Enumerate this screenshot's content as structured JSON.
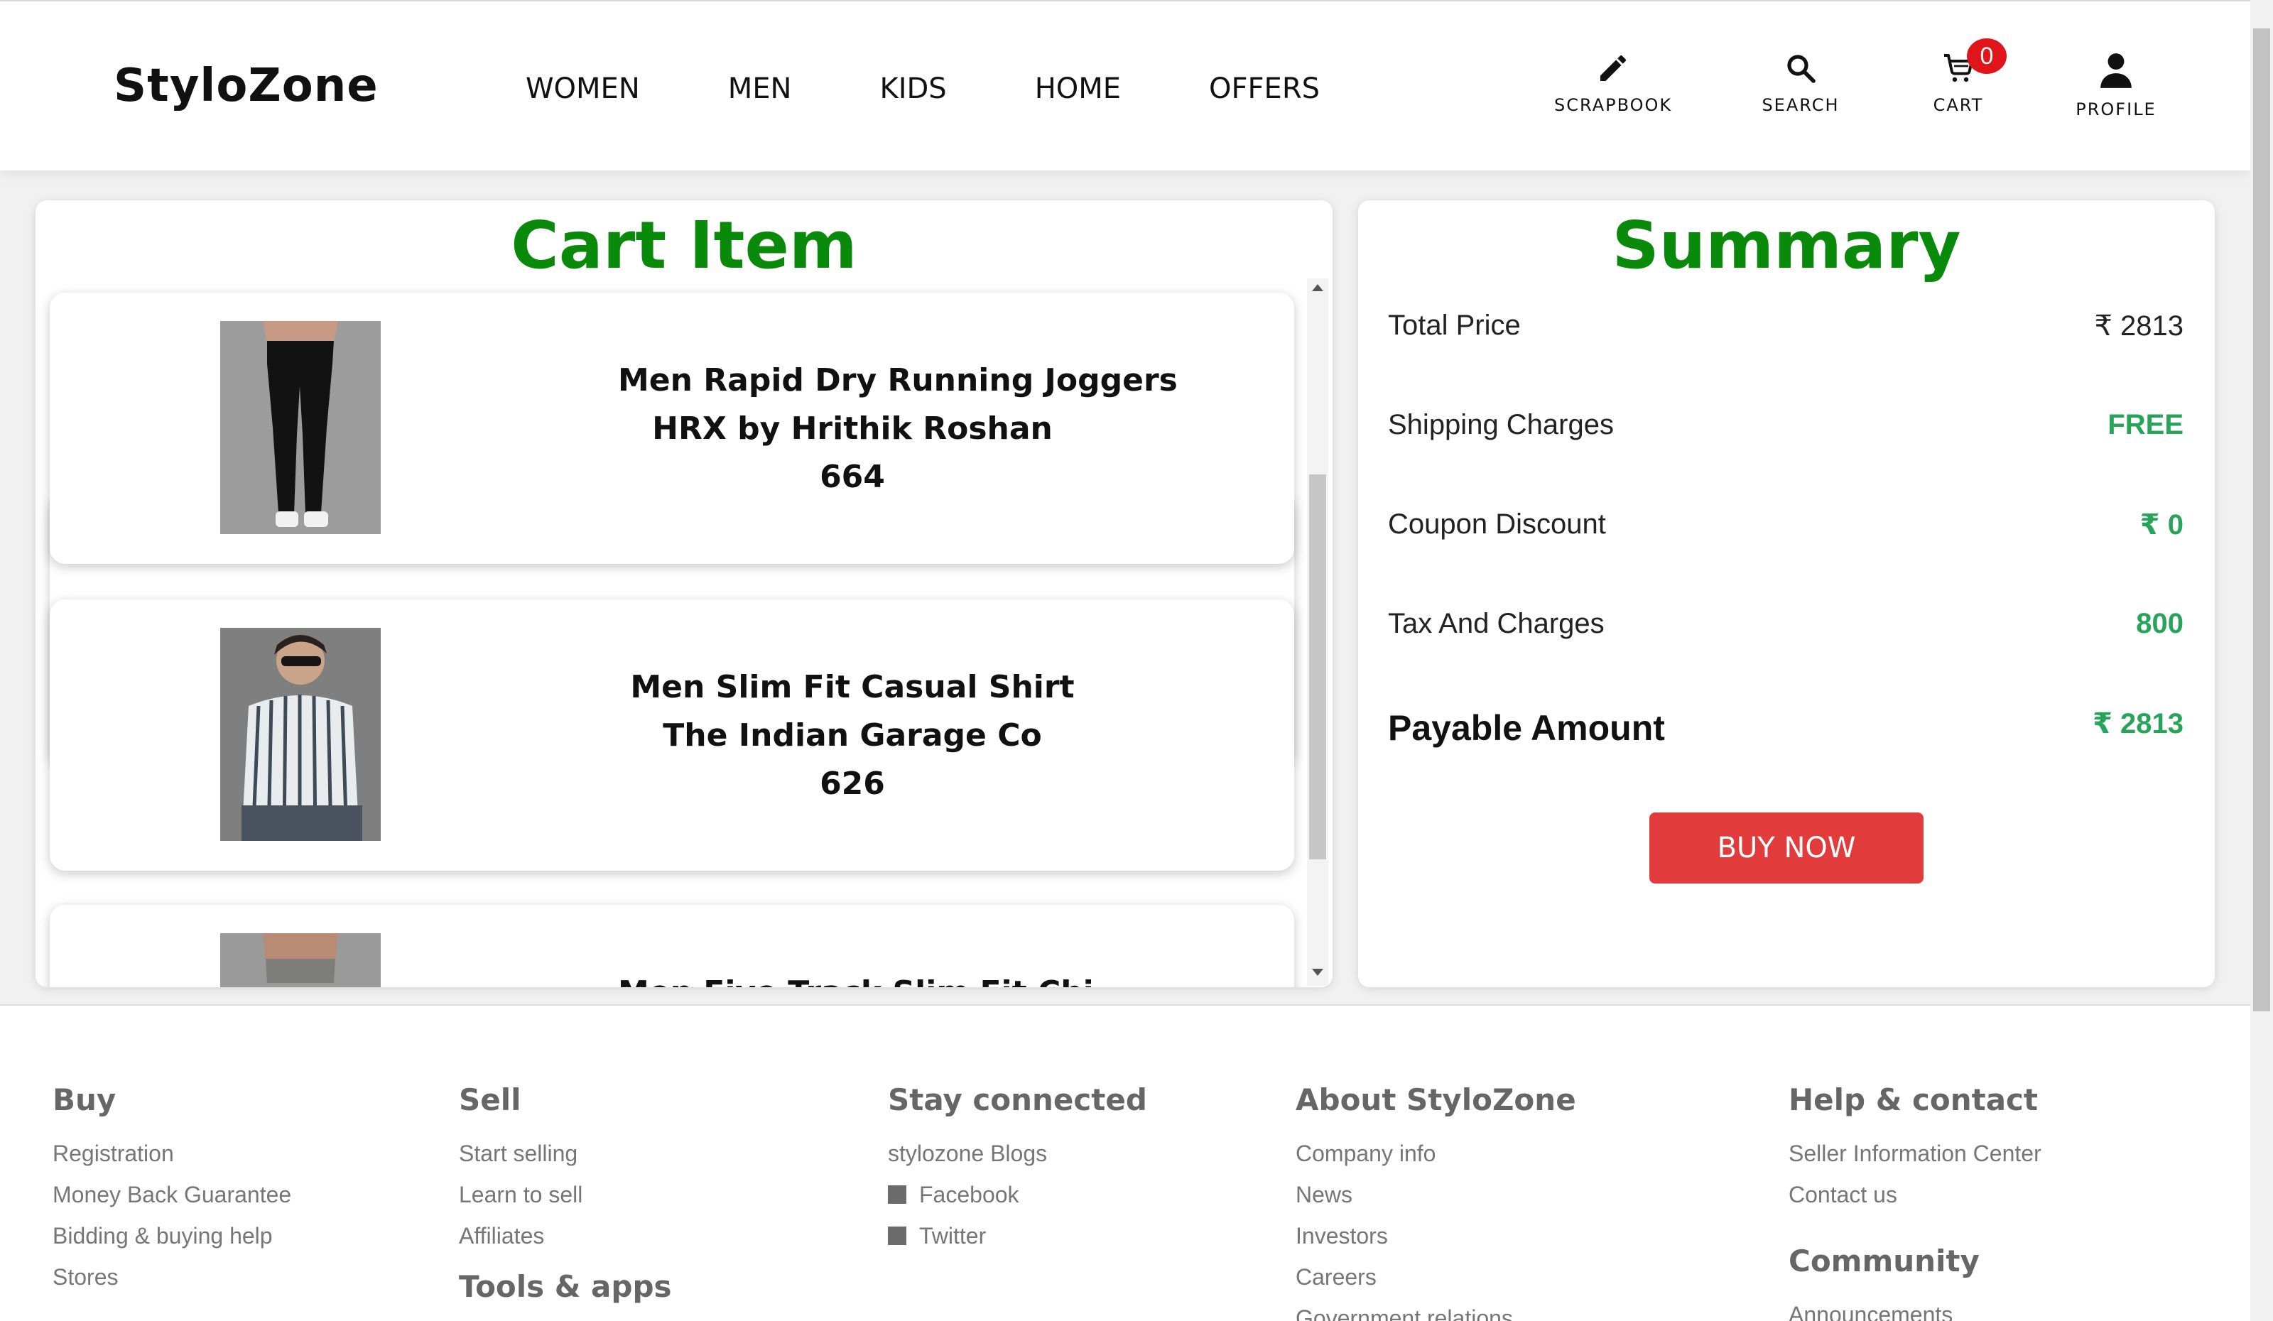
{
  "header": {
    "logo": "StyloZone",
    "nav": [
      "WOMEN",
      "MEN",
      "KIDS",
      "HOME",
      "OFFERS"
    ],
    "actions": {
      "scrapbook": "SCRAPBOOK",
      "search": "SEARCH",
      "cart": "CART",
      "cart_count": "0",
      "profile": "PROFILE"
    }
  },
  "cart": {
    "title": "Cart Item",
    "items": [
      {
        "name": "Men Rapid Dry Running Joggers",
        "brand": "HRX by Hrithik Roshan",
        "price": "664"
      },
      {
        "name": "Men Slim Fit Casual Shirt",
        "brand": "The Indian Garage Co",
        "price": "626"
      },
      {
        "name": "Men Five Track Slim Fit Chi"
      }
    ]
  },
  "summary": {
    "title": "Summary",
    "total_price_label": "Total Price",
    "total_price_value": "₹ 2813",
    "shipping_label": "Shipping Charges",
    "shipping_value": "FREE",
    "coupon_label": "Coupon Discount",
    "coupon_value": "₹ 0",
    "tax_label": "Tax And Charges",
    "tax_value": "800",
    "payable_label": "Payable Amount",
    "payable_value": "₹ 2813",
    "buy_label": "BUY NOW"
  },
  "footer": {
    "buy": {
      "title": "Buy",
      "links": [
        "Registration",
        "Money Back Guarantee",
        "Bidding & buying help",
        "Stores"
      ]
    },
    "sell": {
      "title": "Sell",
      "links": [
        "Start selling",
        "Learn to sell",
        "Affiliates"
      ]
    },
    "tools": {
      "title": "Tools & apps"
    },
    "stay": {
      "title": "Stay connected",
      "links": [
        "stylozone Blogs",
        "Facebook",
        "Twitter"
      ]
    },
    "about": {
      "title": "About StyloZone",
      "links": [
        "Company info",
        "News",
        "Investors",
        "Careers",
        "Government relations"
      ]
    },
    "help": {
      "title": "Help & contact",
      "links": [
        "Seller Information Center",
        "Contact us"
      ]
    },
    "community": {
      "title": "Community",
      "links": [
        "Announcements"
      ]
    }
  },
  "colors": {
    "title_green": "#0a8a0a",
    "value_green": "#28a45a",
    "buy_red": "#e23b3b",
    "badge_red": "#e0151a"
  }
}
